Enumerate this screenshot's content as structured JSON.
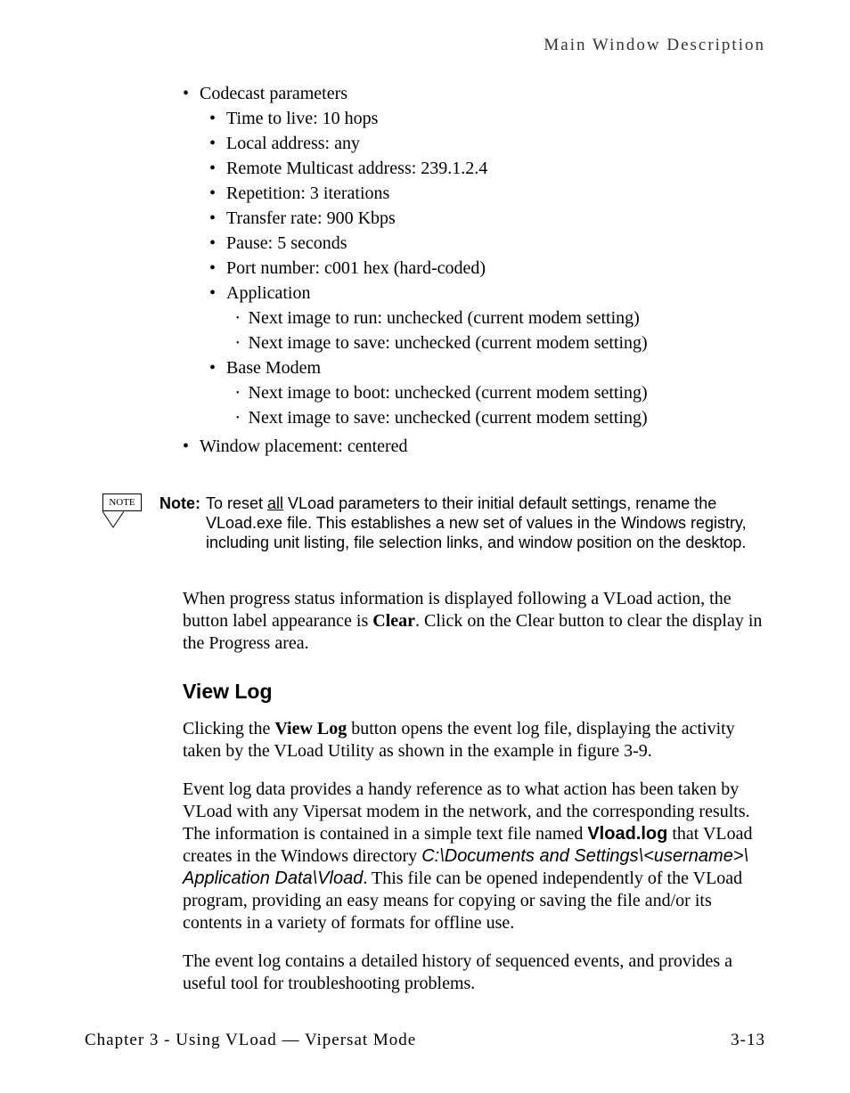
{
  "header": "Main Window Description",
  "bullets": {
    "codecast": "Codecast parameters",
    "codecast_items": {
      "ttl": "Time to live: 10 hops",
      "local": "Local address: any",
      "remote": "Remote Multicast address: 239.1.2.4",
      "repetition": "Repetition: 3 iterations",
      "rate": "Transfer rate: 900 Kbps",
      "pause": "Pause: 5 seconds",
      "port": "Port number: c001 hex (hard-coded)",
      "application": "Application",
      "app_run": "Next image to run: unchecked (current modem setting)",
      "app_save": "Next image to save: unchecked (current modem setting)",
      "basemodem": "Base Modem",
      "bm_boot": "Next image to boot: unchecked (current modem setting)",
      "bm_save": "Next image to save: unchecked (current modem setting)"
    },
    "window": "Window placement: centered"
  },
  "note": {
    "iconLabel": "NOTE",
    "label": "Note:",
    "text1": "To reset ",
    "all": "all",
    "text2": " VLoad parameters to their initial default settings, rename the VLoad.exe file. This establishes a new set of values in the Windows registry, including unit listing, file selection links, and window position on the desktop."
  },
  "para1a": "When progress status information is displayed following a VLoad action, the button label appearance is ",
  "para1_clear": "Clear",
  "para1b": ". Click on the Clear button to clear the display in the Progress area.",
  "heading": "View Log",
  "para2a": "Clicking the ",
  "para2_viewlog": "View Log",
  "para2b": " button opens the event log file, displaying the activity taken by the VLoad Utility as shown in the example in figure 3-9.",
  "para3a": "Event log data provides a handy reference as to what action has been taken by VLoad with any Vipersat modem in the network, and the corresponding results. The information is contained in a simple text file named ",
  "para3_vloadlog": "Vload.log",
  "para3b": " that VLoad creates in the Windows directory ",
  "para3_path": "C:\\Documents and Settings\\<username>\\ Application Data\\Vload",
  "para3c": ". This file can be opened independently of the VLoad program, providing an easy means for copying or saving the file and/or its contents in a variety of formats for offline use.",
  "para4": "The event log contains a detailed history of sequenced events, and provides a useful tool for troubleshooting problems.",
  "footer": {
    "left": "Chapter 3 - Using VLoad — Vipersat Mode",
    "right": "3-13"
  }
}
